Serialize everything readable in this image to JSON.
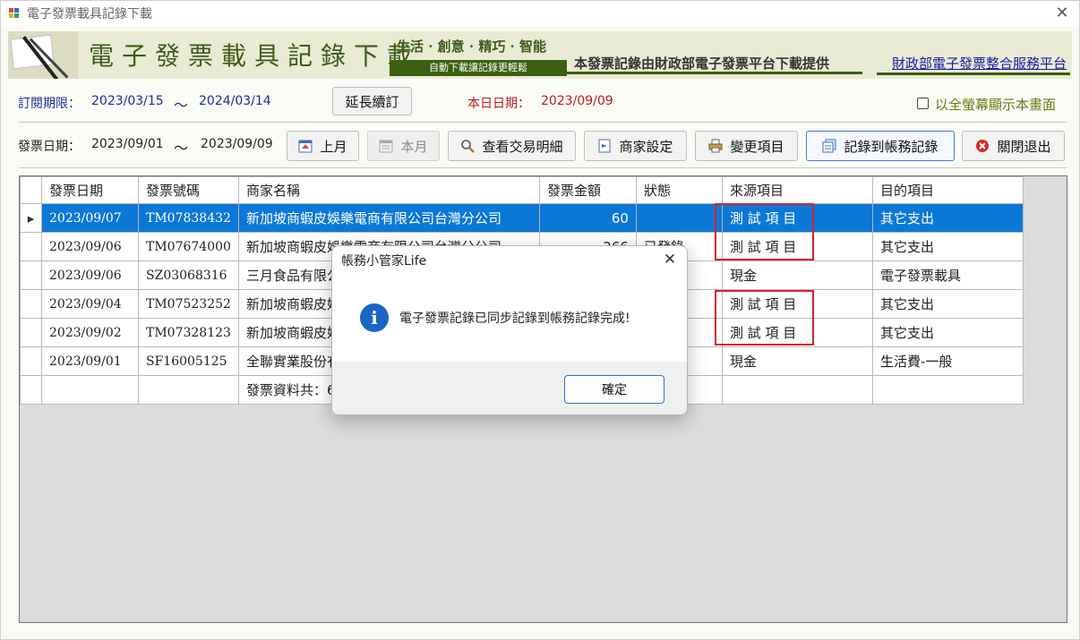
{
  "window": {
    "title": "電子發票載具記錄下載",
    "close_glyph": "✕"
  },
  "banner": {
    "title": "電子發票載具記錄下載",
    "slogan": "生活 · 創意 · 精巧 · 智能",
    "slogan_sub": "自動下載讓記錄更輕鬆",
    "description": "本發票記錄由財政部電子發票平台下載提供",
    "link": "財政部電子發票整合服務平台"
  },
  "subscription": {
    "label": "訂閱期限：",
    "start": "2023/03/15",
    "tilde": "～",
    "end": "2024/03/14",
    "extend_button": "延長續訂",
    "today_label": "本日日期：",
    "today": "2023/09/09",
    "fullscreen_label": "以全螢幕顯示本畫面",
    "fullscreen_checked": false
  },
  "filter": {
    "label": "發票日期：",
    "start": "2023/09/01",
    "tilde": "～",
    "end": "2023/09/09"
  },
  "toolbar": {
    "prev_month": "上月",
    "this_month": "本月",
    "view_details": "查看交易明細",
    "merchant_settings": "商家設定",
    "change_item": "變更項目",
    "record_to_accounts": "記錄到帳務記錄",
    "close_exit": "關閉退出"
  },
  "grid": {
    "columns": [
      "發票日期",
      "發票號碼",
      "商家名稱",
      "發票金額",
      "狀態",
      "來源項目",
      "目的項目"
    ],
    "rows": [
      {
        "date": "2023/09/07",
        "number": "TM07838432",
        "merchant": "新加坡商蝦皮娛樂電商有限公司台灣分公司",
        "amount": "60",
        "status": "",
        "source": "測 試 項 目",
        "target": "其它支出",
        "selected": true
      },
      {
        "date": "2023/09/06",
        "number": "TM07674000",
        "merchant": "新加坡商蝦皮娛樂電商有限公司台灣分公司",
        "amount": "266",
        "status": "已發錄",
        "source": "測 試 項 目",
        "target": "其它支出"
      },
      {
        "date": "2023/09/06",
        "number": "SZ03068316",
        "merchant": "三月食品有限公",
        "amount": "",
        "status": "",
        "source": "現金",
        "target": "電子發票載具"
      },
      {
        "date": "2023/09/04",
        "number": "TM07523252",
        "merchant": "新加坡商蝦皮娛",
        "amount": "",
        "status": "",
        "source": "測 試 項 目",
        "target": "其它支出"
      },
      {
        "date": "2023/09/02",
        "number": "TM07328123",
        "merchant": "新加坡商蝦皮娛",
        "amount": "",
        "status": "",
        "source": "測 試 項 目",
        "target": "其它支出"
      },
      {
        "date": "2023/09/01",
        "number": "SF16005125",
        "merchant": "全聯實業股份有",
        "amount": "",
        "status": "",
        "source": "現金",
        "target": "生活費-一般"
      }
    ],
    "summary": "發票資料共：6",
    "row_indicator": "▸"
  },
  "dialog": {
    "title": "帳務小管家Life",
    "close_glyph": "✕",
    "icon_glyph": "i",
    "message": "電子發票記錄已同步記錄到帳務記錄完成!",
    "ok_button": "確定"
  },
  "colors": {
    "selection": "#0b78d7",
    "highlight_box": "#d8232a",
    "banner_green": "#3d5f12",
    "label_blue": "#1e2f9a",
    "label_red": "#b22020"
  },
  "icons": {
    "prev_month": "calendar-up-icon",
    "this_month": "calendar-icon",
    "view_details": "magnifier-icon",
    "merchant_settings": "store-icon",
    "change_item": "printer-icon",
    "record_to_accounts": "ledger-icon",
    "close_exit": "close-circle-icon"
  }
}
